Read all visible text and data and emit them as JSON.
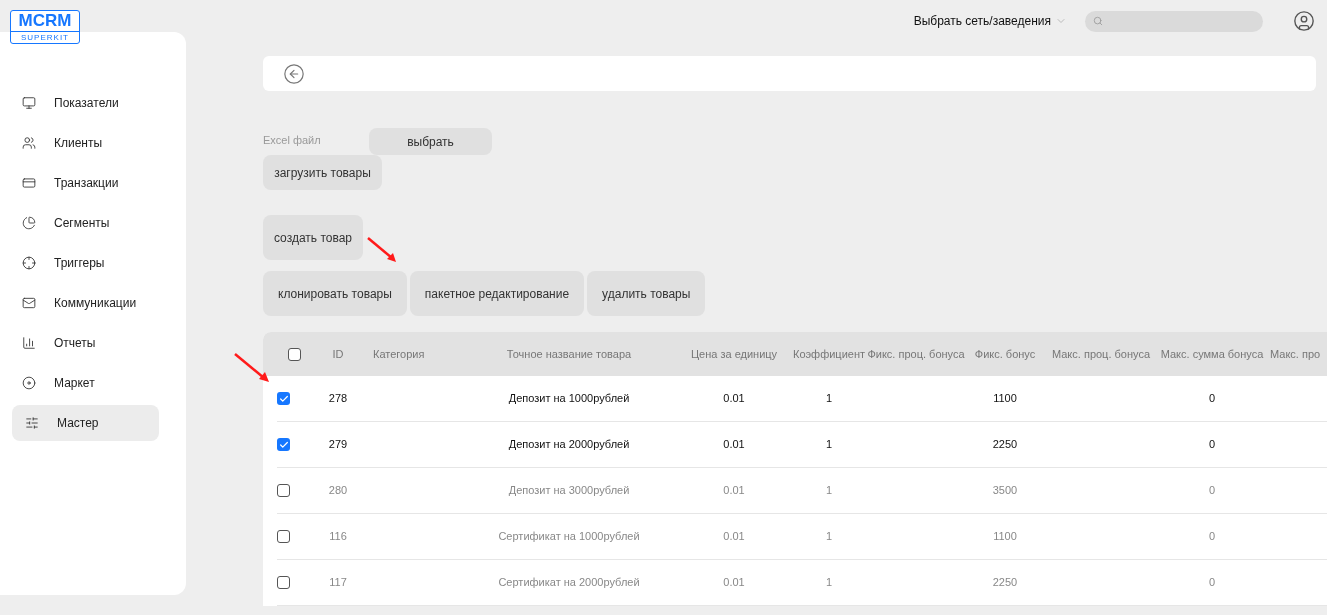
{
  "logo": {
    "title": "MCRM",
    "subtitle": "SUPERKIT"
  },
  "top_bar": {
    "network_select": "Выбрать сеть/заведения"
  },
  "sidebar": {
    "items": [
      {
        "label": "Показатели",
        "selected": false
      },
      {
        "label": "Клиенты",
        "selected": false
      },
      {
        "label": "Транзакции",
        "selected": false
      },
      {
        "label": "Сегменты",
        "selected": false
      },
      {
        "label": "Триггеры",
        "selected": false
      },
      {
        "label": "Коммуникации",
        "selected": false
      },
      {
        "label": "Отчеты",
        "selected": false
      },
      {
        "label": "Маркет",
        "selected": false
      },
      {
        "label": "Мастер",
        "selected": true
      }
    ]
  },
  "upload": {
    "file_label": "Excel файл",
    "choose_button": "выбрать",
    "upload_button": "загрузить товары"
  },
  "actions": {
    "create_button": "создать товар",
    "bulk_buttons": [
      "клонировать товары",
      "пакетное редактирование",
      "удалить товары"
    ]
  },
  "table": {
    "select_all": false,
    "columns": [
      "ID",
      "Категория",
      "Точное название товара",
      "Цена за единицу",
      "Коэффициент",
      "Фикс. проц. бонуса",
      "Фикс. бонус",
      "Макс. проц. бонуса",
      "Макс. сумма бонуса",
      "Макс. про"
    ],
    "rows": [
      {
        "selected": true,
        "cells": [
          "278",
          "",
          "Депозит на 1000рублей",
          "0.01",
          "1",
          "",
          "1100",
          "",
          "0",
          ""
        ]
      },
      {
        "selected": true,
        "cells": [
          "279",
          "",
          "Депозит на 2000рублей",
          "0.01",
          "1",
          "",
          "2250",
          "",
          "0",
          ""
        ]
      },
      {
        "selected": false,
        "cells": [
          "280",
          "",
          "Депозит на 3000рублей",
          "0.01",
          "1",
          "",
          "3500",
          "",
          "0",
          ""
        ]
      },
      {
        "selected": false,
        "cells": [
          "116",
          "",
          "Сертификат на 1000рублей",
          "0.01",
          "1",
          "",
          "1100",
          "",
          "0",
          ""
        ]
      },
      {
        "selected": false,
        "cells": [
          "117",
          "",
          "Сертификат на 2000рублей",
          "0.01",
          "1",
          "",
          "2250",
          "",
          "0",
          ""
        ]
      }
    ]
  }
}
